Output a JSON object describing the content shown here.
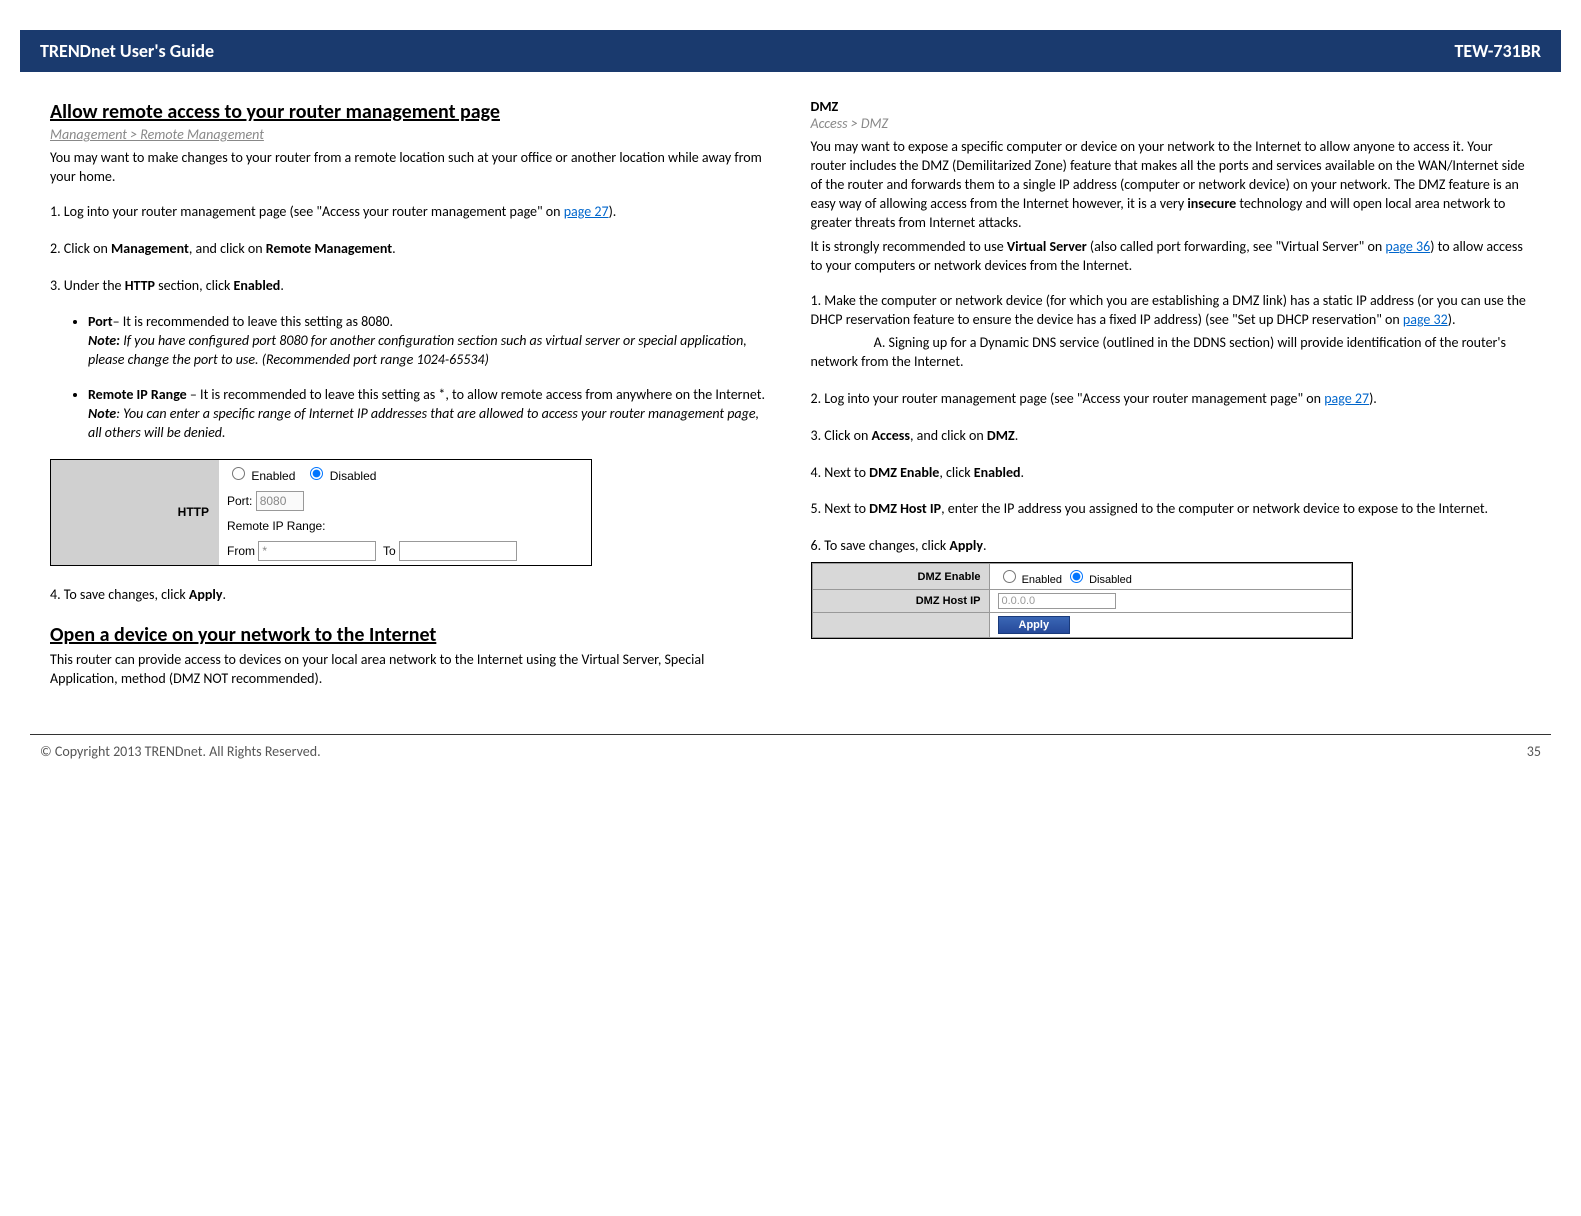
{
  "header": {
    "title": "TRENDnet User's Guide",
    "model": "TEW-731BR"
  },
  "left": {
    "h2a": "Allow remote access to your router management page",
    "crumb_a": "Management > Remote Management",
    "intro_a": "You may want to make changes to your router from a remote location such at your office or another location while away from your home.",
    "step1_pre": "1. Log into your router management page (see \"Access your router management page\" on ",
    "page27": "page 27",
    "step1_post": ").",
    "step2_pre": "2. Click on ",
    "step2_b1": "Management",
    "step2_mid": ", and click on ",
    "step2_b2": "Remote Management",
    "step2_post": ".",
    "step3_pre": "3. Under the ",
    "step3_b1": "HTTP",
    "step3_mid": " section, click ",
    "step3_b2": "Enabled",
    "step3_post": ".",
    "bullet1_b": "Port",
    "bullet1_txt": "– It is recommended to leave this setting as 8080.",
    "bullet1_note_b": "Note:",
    "bullet1_note": " If you have configured port 8080 for another configuration section such as virtual server or special application, please change the port to use. (Recommended port range 1024-65534)",
    "bullet2_b": "Remote IP Range",
    "bullet2_txt": " – It is recommended to leave this setting as *, to allow remote access from anywhere on the Internet.",
    "bullet2_note_b": "Note",
    "bullet2_note": ": You can enter a specific range of Internet IP addresses that are allowed to access your router management page, all others will be denied.",
    "http_label": "HTTP",
    "radio_enabled": "Enabled",
    "radio_disabled": "Disabled",
    "port_label": "Port:",
    "port_value": "8080",
    "rir_label": "Remote IP Range:",
    "from_label": "From",
    "from_value": "*",
    "to_label": "To",
    "step4_pre": "4. To save changes, click ",
    "step4_b": "Apply",
    "step4_post": ".",
    "h2b": "Open a device on your network to the Internet",
    "open_intro": "This router can provide access to devices on your local area network to the Internet using the Virtual Server, Special Application, method (DMZ NOT recommended)."
  },
  "right": {
    "subhead": "DMZ",
    "crumb": "Access > DMZ",
    "p1_pre": "You may want to expose a specific computer or device on your network to the Internet to allow anyone to access it. Your router includes the DMZ (Demilitarized Zone) feature that makes all the ports and services available on the WAN/Internet side of the router and forwards them to a single IP address (computer or network device) on your network. The DMZ feature is an easy way of allowing access from the Internet however, it is a very ",
    "p1_b": "insecure",
    "p1_post": " technology and will open local area network to greater threats from Internet attacks.",
    "p2_pre": "It is strongly recommended to use ",
    "p2_b": "Virtual Server",
    "p2_mid": " (also called port forwarding, see \"Virtual Server\" on ",
    "page36": "page 36",
    "p2_post": ") to allow access to your computers or network devices from the Internet.",
    "s1_pre": "1. Make the computer or network device (for which you are establishing a DMZ link) has a static IP address (or you can use the DHCP reservation feature to ensure the device has a fixed IP address) (see \"Set up DHCP reservation\" on ",
    "page32": "page 32",
    "s1_post": ").",
    "s1a": "A. Signing up for a Dynamic DNS service (outlined in the DDNS section) will provide identification of the router's network from the Internet.",
    "s2_pre": "2. Log into your router management page (see \"Access your router management page\" on ",
    "s2_post": ").",
    "s3_pre": "3. Click on ",
    "s3_b1": "Access",
    "s3_mid": ", and click on ",
    "s3_b2": "DMZ",
    "s3_post": ".",
    "s4_pre": "4. Next to ",
    "s4_b1": "DMZ Enable",
    "s4_mid": ", click ",
    "s4_b2": "Enabled",
    "s4_post": ".",
    "s5_pre": "5. Next to ",
    "s5_b1": "DMZ Host IP",
    "s5_post": ", enter the IP address you assigned to the computer or network device to expose to the Internet.",
    "s6_pre": "6. To save changes, click ",
    "s6_b": "Apply",
    "s6_post": ".",
    "dmz_enable_label": "DMZ Enable",
    "dmz_host_label": "DMZ Host IP",
    "dmz_host_value": "0.0.0.0",
    "apply_btn": "Apply"
  },
  "footer": {
    "copyright": "© Copyright 2013 TRENDnet. All Rights Reserved.",
    "page": "35"
  }
}
